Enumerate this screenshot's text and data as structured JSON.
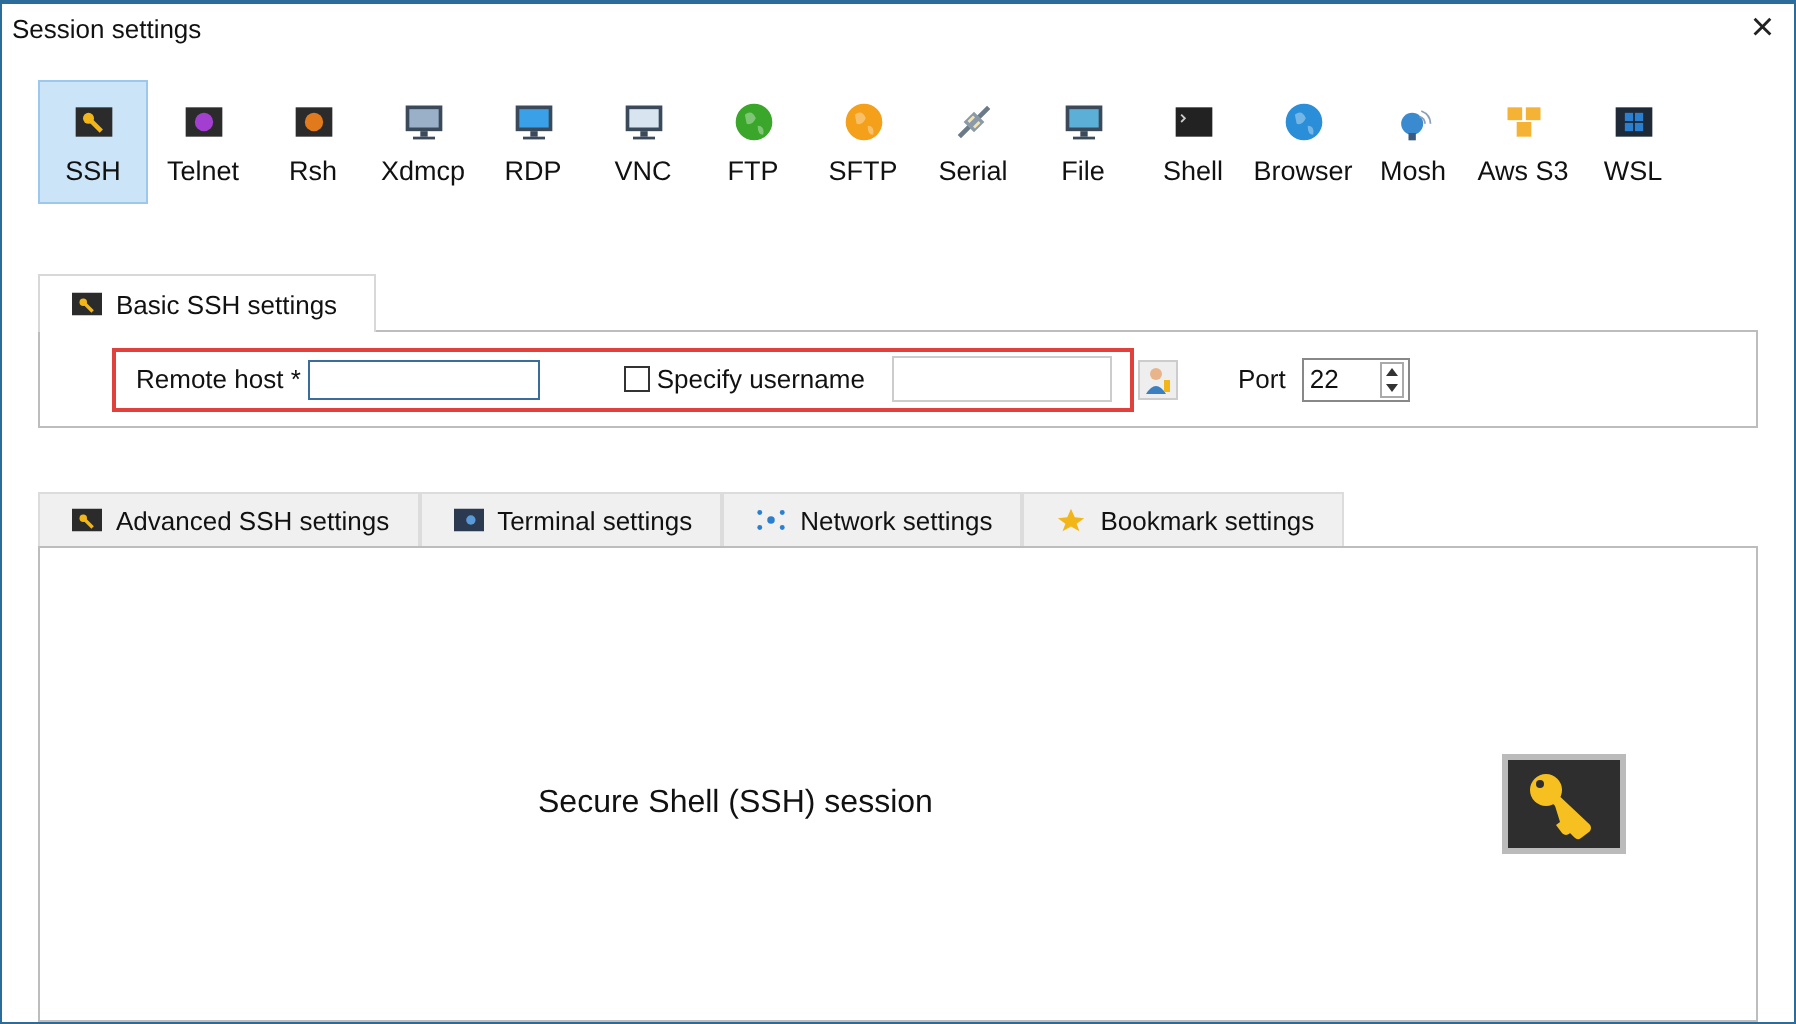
{
  "window": {
    "title": "Session settings",
    "close": "×"
  },
  "session_types": [
    {
      "label": "SSH",
      "kind": "key",
      "color": "#f2b619",
      "selected": true
    },
    {
      "label": "Telnet",
      "kind": "badge",
      "color": "#a23fd0",
      "selected": false
    },
    {
      "label": "Rsh",
      "kind": "badge",
      "color": "#e07a1c",
      "selected": false
    },
    {
      "label": "Xdmcp",
      "kind": "monitor",
      "color": "#9ab0c8",
      "selected": false
    },
    {
      "label": "RDP",
      "kind": "monitor",
      "color": "#3aa0e8",
      "selected": false
    },
    {
      "label": "VNC",
      "kind": "monitor",
      "color": "#d8e4f0",
      "selected": false
    },
    {
      "label": "FTP",
      "kind": "globe",
      "color": "#3aa62a",
      "selected": false
    },
    {
      "label": "SFTP",
      "kind": "globe",
      "color": "#f5a01a",
      "selected": false
    },
    {
      "label": "Serial",
      "kind": "plug",
      "color": "#8a9aa8",
      "selected": false
    },
    {
      "label": "File",
      "kind": "monitor",
      "color": "#5cb0d8",
      "selected": false
    },
    {
      "label": "Shell",
      "kind": "terminal",
      "color": "#222222",
      "selected": false
    },
    {
      "label": "Browser",
      "kind": "globe",
      "color": "#2a8fd8",
      "selected": false
    },
    {
      "label": "Mosh",
      "kind": "dish",
      "color": "#3a8ad0",
      "selected": false
    },
    {
      "label": "Aws S3",
      "kind": "cubes",
      "color": "#f5b335",
      "selected": false
    },
    {
      "label": "WSL",
      "kind": "tiles",
      "color": "#2a7fd0",
      "selected": false
    }
  ],
  "basic_tab": {
    "label": "Basic SSH settings",
    "selected": true
  },
  "basic_settings": {
    "remote_host_label": "Remote host *",
    "specify_username": {
      "label": "Specify username",
      "checked": false
    },
    "port_label": "Port",
    "port": "22"
  },
  "lower_tabs": [
    {
      "label": "Advanced SSH settings",
      "kind": "key",
      "selected": false
    },
    {
      "label": "Terminal settings",
      "kind": "terminal",
      "selected": false
    },
    {
      "label": "Network settings",
      "kind": "network",
      "selected": false
    },
    {
      "label": "Bookmark settings",
      "kind": "star",
      "selected": false
    }
  ],
  "session_description": "Secure Shell (SSH) session"
}
